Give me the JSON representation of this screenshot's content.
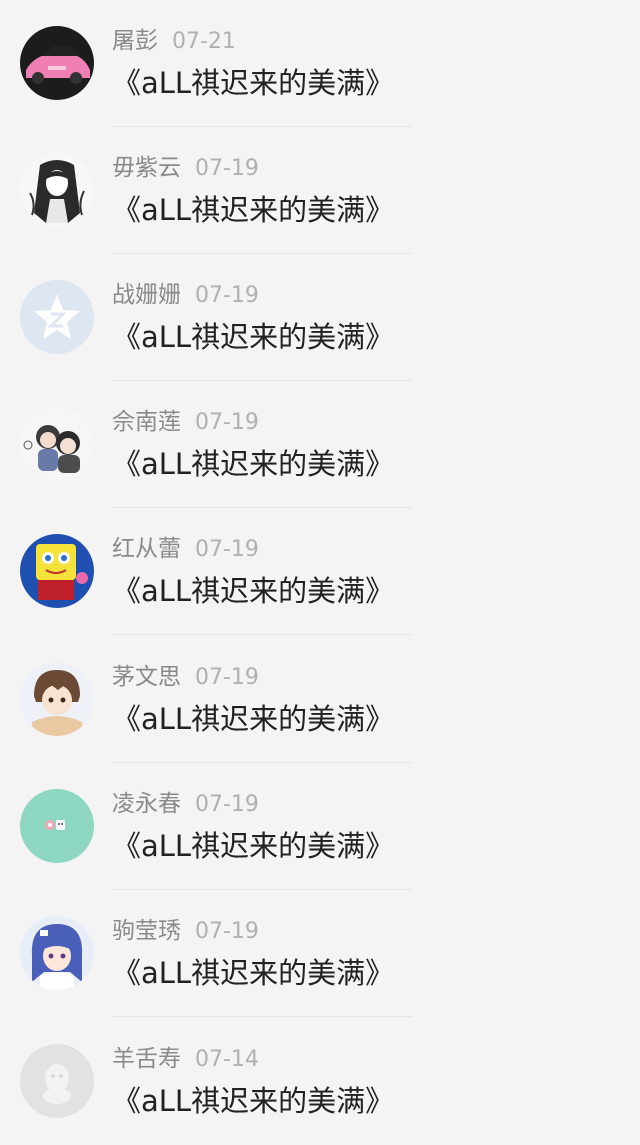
{
  "messages": [
    {
      "name": "屠彭",
      "date": "07-21",
      "text": "《aLL祺迟来的美满》",
      "avatar": "pink-car-avatar"
    },
    {
      "name": "毋紫云",
      "date": "07-19",
      "text": "《aLL祺迟来的美满》",
      "avatar": "manga-girl-avatar"
    },
    {
      "name": "战姗姗",
      "date": "07-19",
      "text": "《aLL祺迟来的美满》",
      "avatar": "default-star-avatar"
    },
    {
      "name": "佘南莲",
      "date": "07-19",
      "text": "《aLL祺迟来的美满》",
      "avatar": "chibi-couple-avatar"
    },
    {
      "name": "红从蕾",
      "date": "07-19",
      "text": "《aLL祺迟来的美满》",
      "avatar": "sponge-cartoon-avatar"
    },
    {
      "name": "茅文思",
      "date": "07-19",
      "text": "《aLL祺迟来的美满》",
      "avatar": "anime-boy-avatar"
    },
    {
      "name": "凌永春",
      "date": "07-19",
      "text": "《aLL祺迟来的美满》",
      "avatar": "mint-cute-avatar"
    },
    {
      "name": "驹莹琇",
      "date": "07-19",
      "text": "《aLL祺迟来的美满》",
      "avatar": "blue-hair-anime-avatar"
    },
    {
      "name": "羊舌寿",
      "date": "07-14",
      "text": "《aLL祺迟来的美满》",
      "avatar": "default-penguin-avatar"
    }
  ]
}
